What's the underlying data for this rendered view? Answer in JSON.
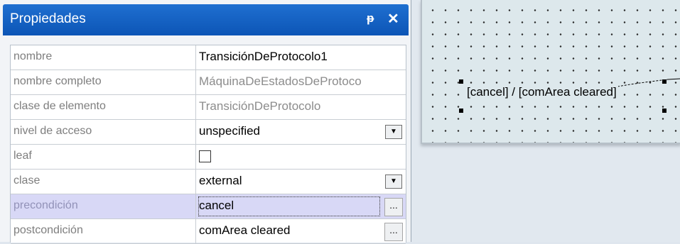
{
  "panel": {
    "title": "Propiedades",
    "pin_glyph": "ᵽ",
    "close_glyph": "✕",
    "rows": [
      {
        "label": "nombre",
        "value": "TransiciónDeProtocolo1"
      },
      {
        "label": "nombre completo",
        "value": "MáquinaDeEstadosDeProtoco"
      },
      {
        "label": "clase de elemento",
        "value": "TransiciónDeProtocolo"
      },
      {
        "label": "nivel de acceso",
        "value": "unspecified"
      },
      {
        "label": "leaf",
        "value": ""
      },
      {
        "label": "clase",
        "value": "external"
      },
      {
        "label": "precondición",
        "value": "cancel"
      },
      {
        "label": "postcondición",
        "value": "comArea cleared"
      }
    ],
    "dropdown_glyph": "▼",
    "ellipsis_glyph": "..."
  },
  "diagram": {
    "transition_label": "[cancel] / [comArea cleared]"
  },
  "colors": {
    "title_bar": "#1565c8",
    "selected_row": "#d8d8f6",
    "canvas": "#dde8ec"
  }
}
